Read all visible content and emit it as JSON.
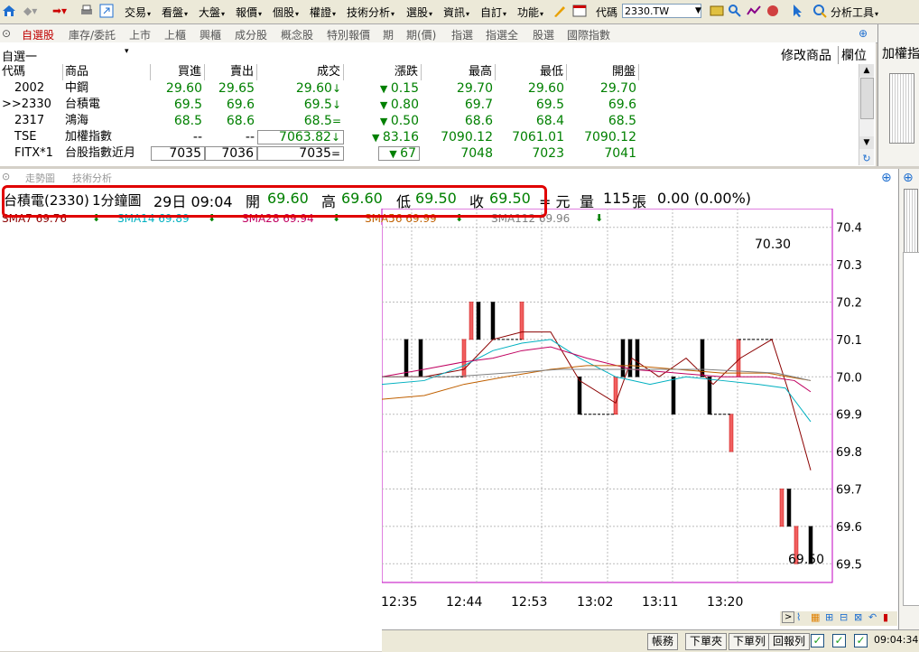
{
  "menubar": {
    "items": [
      "交易",
      "看盤",
      "大盤",
      "報價",
      "個股",
      "權證",
      "技術分析",
      "選股",
      "資訊",
      "自訂",
      "功能"
    ],
    "code_label": "代碼",
    "code_value": "2330.TW",
    "analysis_tools": "分析工具"
  },
  "tabs": [
    "自選股",
    "庫存/委託",
    "上市",
    "上櫃",
    "興櫃",
    "成分股",
    "概念股",
    "特別報價",
    "期",
    "期(價)",
    "指選",
    "指選全",
    "股選",
    "國際指數"
  ],
  "watchlist": {
    "name": "自選一",
    "modify_label": "修改商品",
    "field_label": "欄位",
    "right_label": "加權指",
    "columns": [
      "代碼",
      "商品",
      "買進",
      "賣出",
      "成交",
      "漲跌",
      "最高",
      "最低",
      "開盤"
    ],
    "rows": [
      {
        "code": "2002",
        "name": "中鋼",
        "bid": "29.60",
        "ask": "29.65",
        "last": "29.60",
        "last_mark": "↓",
        "chg": "0.15",
        "high": "29.70",
        "low": "29.60",
        "open": "29.70"
      },
      {
        "code": ">>2330",
        "name": "台積電",
        "bid": "69.5",
        "ask": "69.6",
        "last": "69.5",
        "last_mark": "↓",
        "chg": "0.80",
        "high": "69.7",
        "low": "69.5",
        "open": "69.6"
      },
      {
        "code": "2317",
        "name": "鴻海",
        "bid": "68.5",
        "ask": "68.6",
        "last": "68.5",
        "last_mark": "=",
        "chg": "0.50",
        "high": "68.6",
        "low": "68.4",
        "open": "68.5"
      },
      {
        "code": "TSE",
        "name": "加權指數",
        "bid": "--",
        "ask": "--",
        "last": "7063.82",
        "last_mark": "↓",
        "chg": "83.16",
        "high": "7090.12",
        "low": "7061.01",
        "open": "7090.12"
      },
      {
        "code": "FITX*1",
        "name": "台股指數近月",
        "bid": "7035",
        "ask": "7036",
        "last": "7035",
        "last_mark": "=",
        "chg": "67",
        "high": "7048",
        "low": "7023",
        "open": "7041"
      }
    ]
  },
  "chart": {
    "tabs": [
      "走勢圖",
      "技術分析"
    ],
    "info": {
      "stock": "台積電(2330)",
      "period": "1分鐘圖",
      "date_time": "29日 09:04",
      "open_label": "開",
      "open": "69.60",
      "high_label": "高",
      "high": "69.60",
      "low_label": "低",
      "low": "69.50",
      "close_label": "收",
      "close": "69.50",
      "unit": "= 元",
      "vol_label": "量",
      "volume": "115",
      "vol_unit": "張",
      "change": "0.00 (0.00%)"
    },
    "ma_legend": [
      {
        "label": "SMA7 69.76",
        "color": "#8b0000"
      },
      {
        "label": "SMA14 69.89",
        "color": "#00b0c0"
      },
      {
        "label": "SMA28 69.94",
        "color": "#c00060"
      },
      {
        "label": "SMA56 69.99",
        "color": "#c06000"
      },
      {
        "label": "SMA112 69.96",
        "color": "#808080"
      }
    ],
    "high_annotation": "70.30",
    "low_annotation": "69.50"
  },
  "chart_data": {
    "type": "candlestick",
    "y_ticks": [
      "70.4",
      "70.3",
      "70.2",
      "70.1",
      "70.0",
      "69.9",
      "69.8",
      "69.7",
      "69.6",
      "69.5"
    ],
    "x_ticks": [
      "12:35",
      "12:44",
      "12:53",
      "13:02",
      "13:11",
      "13:20"
    ],
    "ylim": [
      69.45,
      70.45
    ]
  },
  "statusbar": {
    "buttons": [
      "帳務",
      "下單夾",
      "下單列",
      "回報列"
    ],
    "time": "09:04:34"
  }
}
